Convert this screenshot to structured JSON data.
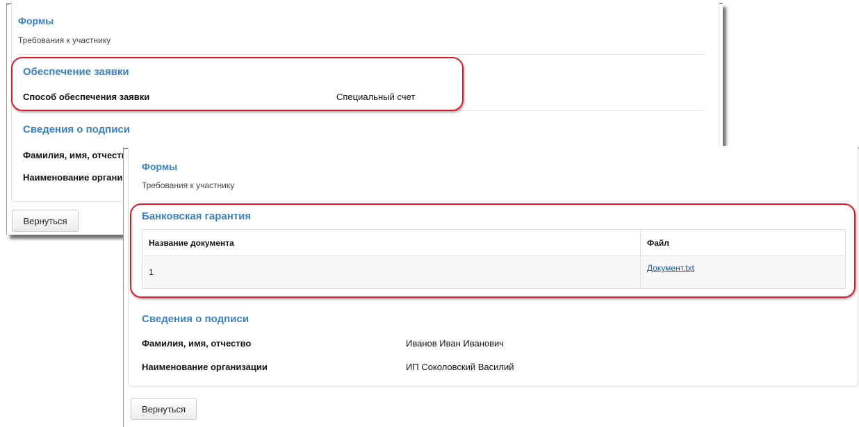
{
  "back_screen": {
    "forms_title": "Формы",
    "participant_requirements": "Требования к участнику",
    "security": {
      "title": "Обеспечение заявки",
      "method_label": "Способ обеспечения заявки",
      "method_value": "Специальный счет"
    },
    "signature": {
      "title": "Сведения о подписи",
      "fio_label": "Фамилия, имя, отчество",
      "org_label": "Наименование организации"
    },
    "back_button": "Вернуться"
  },
  "front_screen": {
    "forms_title": "Формы",
    "participant_requirements": "Требования к участнику",
    "guarantee": {
      "title": "Банковская гарантия",
      "columns": [
        "Название документа",
        "Файл"
      ],
      "rows": [
        {
          "name": "1",
          "file": "Документ.txt"
        }
      ]
    },
    "signature": {
      "title": "Сведения о подписи",
      "fio_label": "Фамилия, имя, отчество",
      "fio_value": "Иванов Иван Иванович",
      "org_label": "Наименование организации",
      "org_value": "ИП Соколовский Василий"
    },
    "back_button": "Вернуться"
  },
  "colors": {
    "section_title": "#3b82c4",
    "highlight": "#e0192a",
    "link": "#1f5fa8"
  }
}
